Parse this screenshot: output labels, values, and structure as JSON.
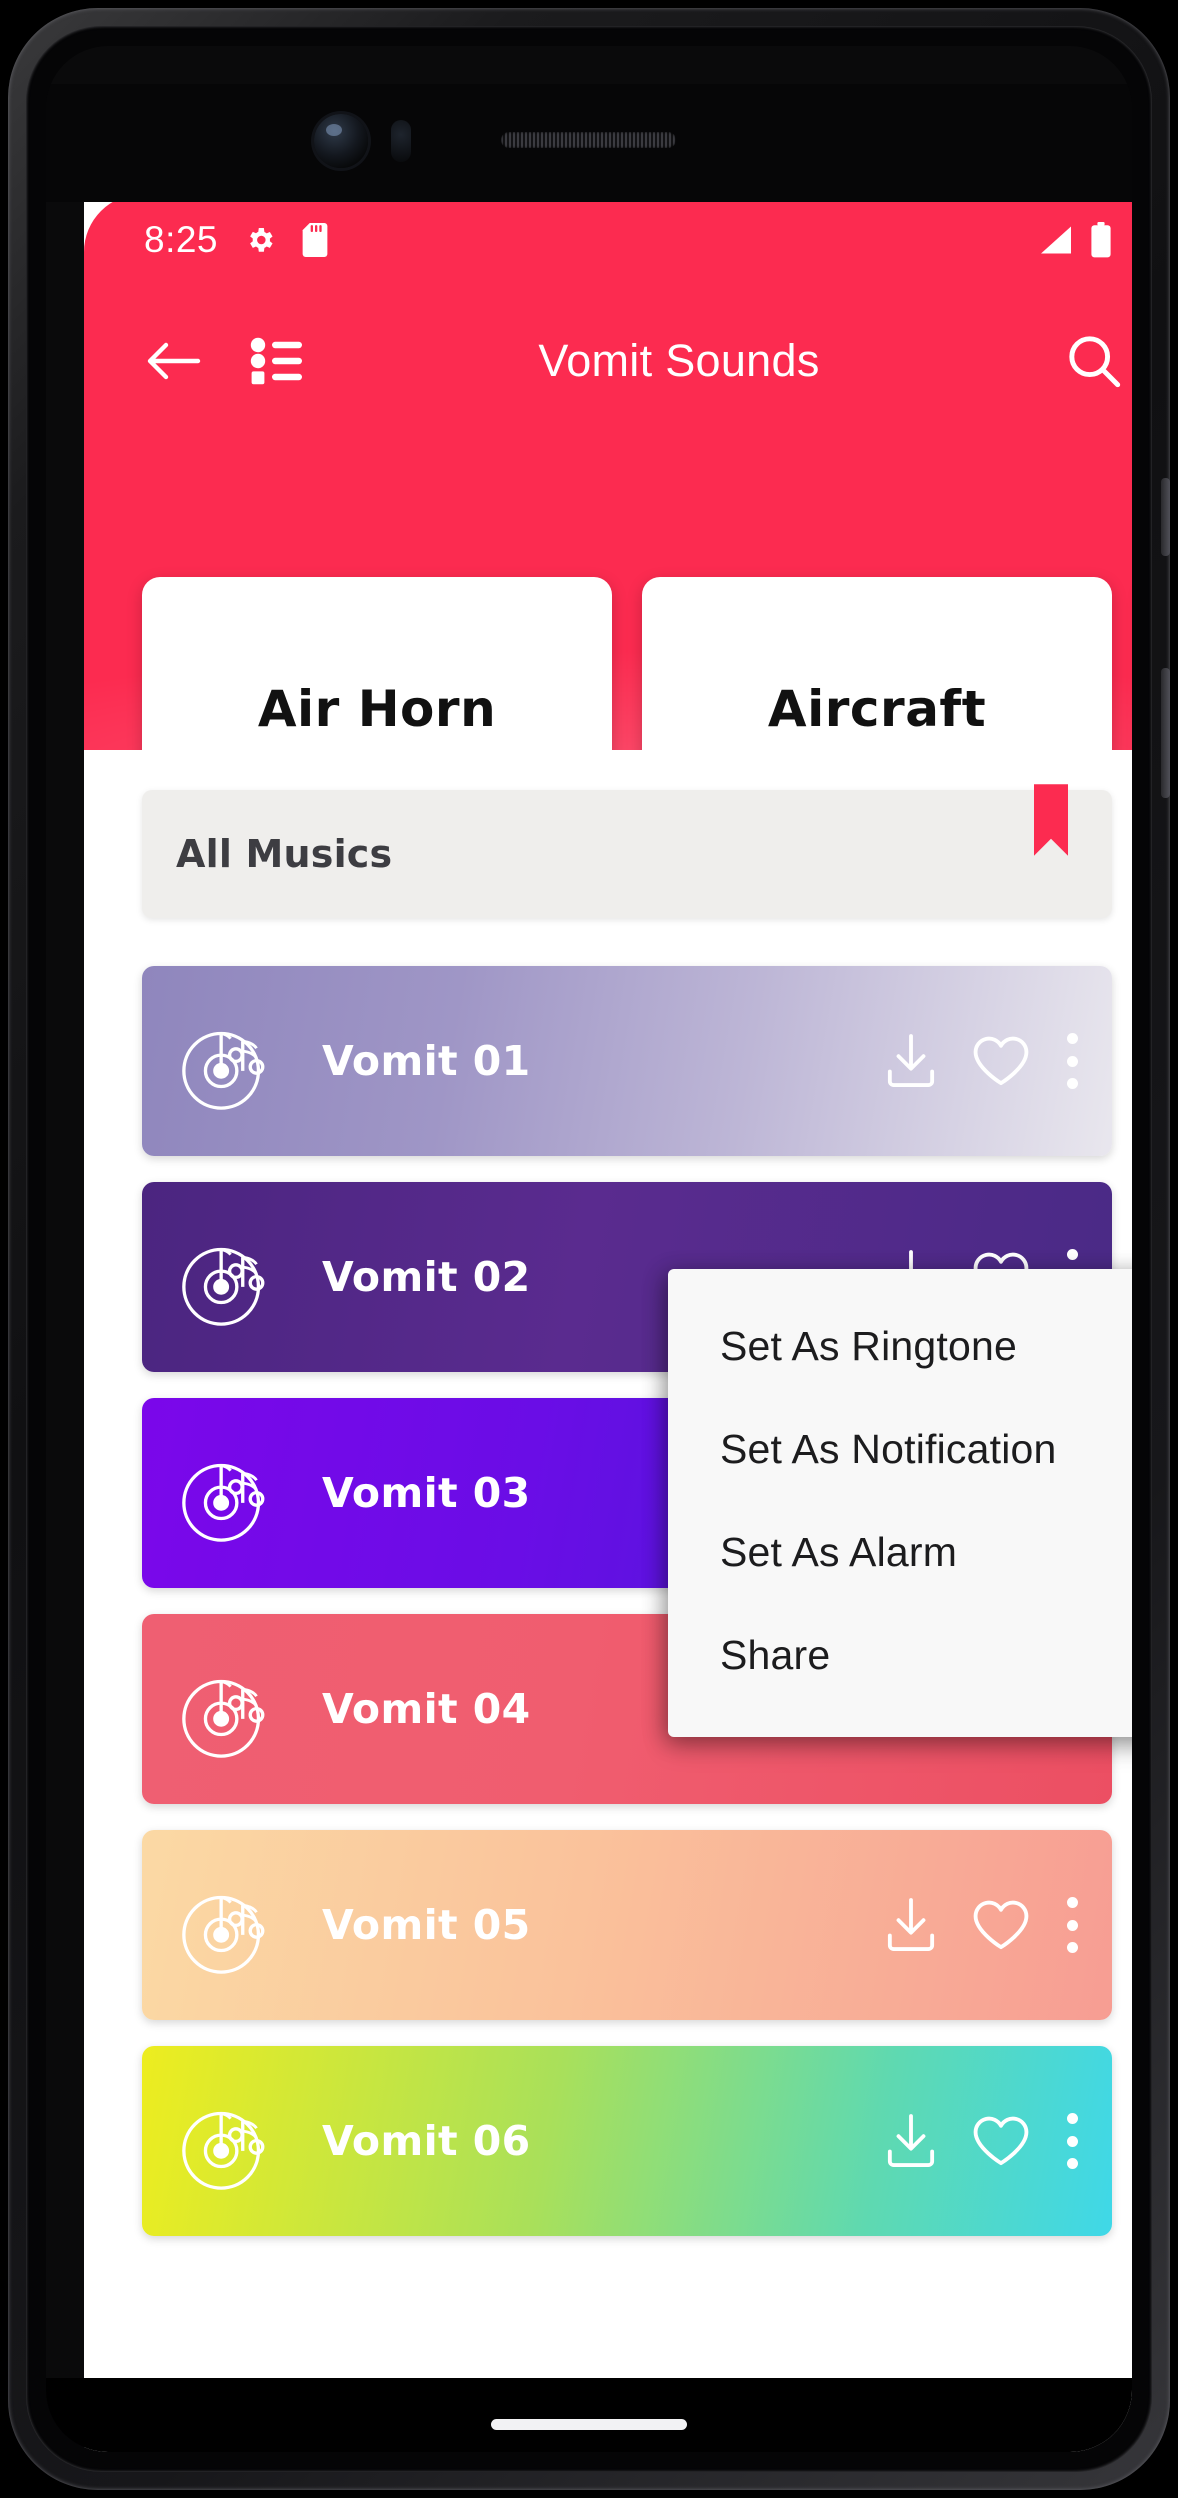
{
  "status_bar": {
    "time": "8:25",
    "icons": [
      "gear-icon",
      "sd-card-icon",
      "signal-icon",
      "battery-icon"
    ]
  },
  "app_bar": {
    "back_icon": "back-arrow-icon",
    "list_icon": "list-menu-icon",
    "title": "Vomit Sounds",
    "search_icon": "search-icon"
  },
  "categories": [
    {
      "label": "Air Horn"
    },
    {
      "label": "Aircraft"
    },
    {
      "label": ""
    }
  ],
  "section": {
    "label": "All Musics",
    "bookmark_icon": "bookmark-icon",
    "bookmark_color": "#FC2B50"
  },
  "tracks": [
    {
      "title": "Vomit 01",
      "gradient": "linear-gradient(100deg,#8f86bd 0%,#9f96c6 32%,#bdb6d6 62%,#e9e7ee 100%)"
    },
    {
      "title": "Vomit 02",
      "gradient": "linear-gradient(100deg,#4b2580 0%,#5a2b8f 45%,#4a2a86 100%)"
    },
    {
      "title": "Vomit 03",
      "gradient": "linear-gradient(100deg,#7b07ea 0%,#6a0de6 40%,#3b22cf 100%)"
    },
    {
      "title": "Vomit 04",
      "gradient": "linear-gradient(100deg,#ef5f72 0%,#f05d6f 45%,#ec4f63 100%)"
    },
    {
      "title": "Vomit 05",
      "gradient": "linear-gradient(100deg,#fbd9a4 0%,#fac29b 45%,#f79d93 100%)"
    },
    {
      "title": "Vomit 06",
      "gradient": "linear-gradient(100deg,#eded1f 0%,#a9e05a 42%,#5fd9b0 75%,#3fd8e8 100%)"
    }
  ],
  "track_icons": {
    "disc": "vinyl-music-icon",
    "download": "download-icon",
    "favorite": "heart-icon",
    "overflow": "more-options-icon"
  },
  "popup_menu": {
    "items": [
      {
        "label": "Set As Ringtone"
      },
      {
        "label": "Set As Notification"
      },
      {
        "label": "Set As Alarm"
      },
      {
        "label": "Share"
      }
    ]
  },
  "theme": {
    "accent": "#FC2B50",
    "section_bg": "#EFEEEC",
    "card_bg": "#FFFFFF",
    "menu_bg": "#F8F8F8"
  }
}
